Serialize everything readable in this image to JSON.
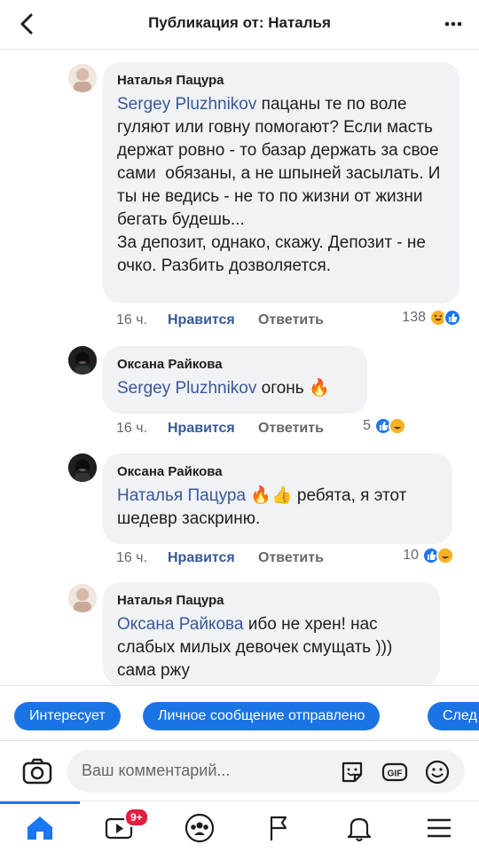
{
  "header": {
    "title": "Публикация от: Наталья"
  },
  "comments": [
    {
      "author": "Наталья Пацура",
      "mention": "Sergey Pluzhnikov",
      "text": " пацаны те по воле гуляют или говну помогают? Если масть держат ровно - то базар держать за свое сами  обязаны, а не шпыней засылать. И ты не ведись - не то по жизни от жизни бегать будешь...\nЗа депозит, однако, скажу. Депозит - не очко. Разбить дозволяется.",
      "time": "16 ч.",
      "like_label": "Нравится",
      "reply_label": "Ответить",
      "reactions_count": "138"
    },
    {
      "author": "Оксана Райкова",
      "mention": "Sergey Pluzhnikov",
      "text": " огонь 🔥",
      "time": "16 ч.",
      "like_label": "Нравится",
      "reply_label": "Ответить",
      "reactions_count": "5"
    },
    {
      "author": "Оксана Райкова",
      "mention": "Наталья Пацура",
      "text": " 🔥👍 ребята, я этот шедевр заскриню.",
      "time": "16 ч.",
      "like_label": "Нравится",
      "reply_label": "Ответить",
      "reactions_count": "10"
    },
    {
      "author": "Наталья Пацура",
      "mention": "Оксана Райкова",
      "text": " ибо не хрен! нас слабых милых девочек смущать )))\nсама ржу"
    }
  ],
  "quick_replies": [
    "Интересует",
    "Личное сообщение отправлено",
    "След"
  ],
  "composer": {
    "placeholder": "Ваш комментарий..."
  },
  "nav": {
    "video_badge": "9+"
  },
  "colors": {
    "accent": "#1877f2",
    "mention": "#385898",
    "bubble": "#f0f2f5",
    "chip": "#1b74e4",
    "badge": "#e41e3f"
  }
}
